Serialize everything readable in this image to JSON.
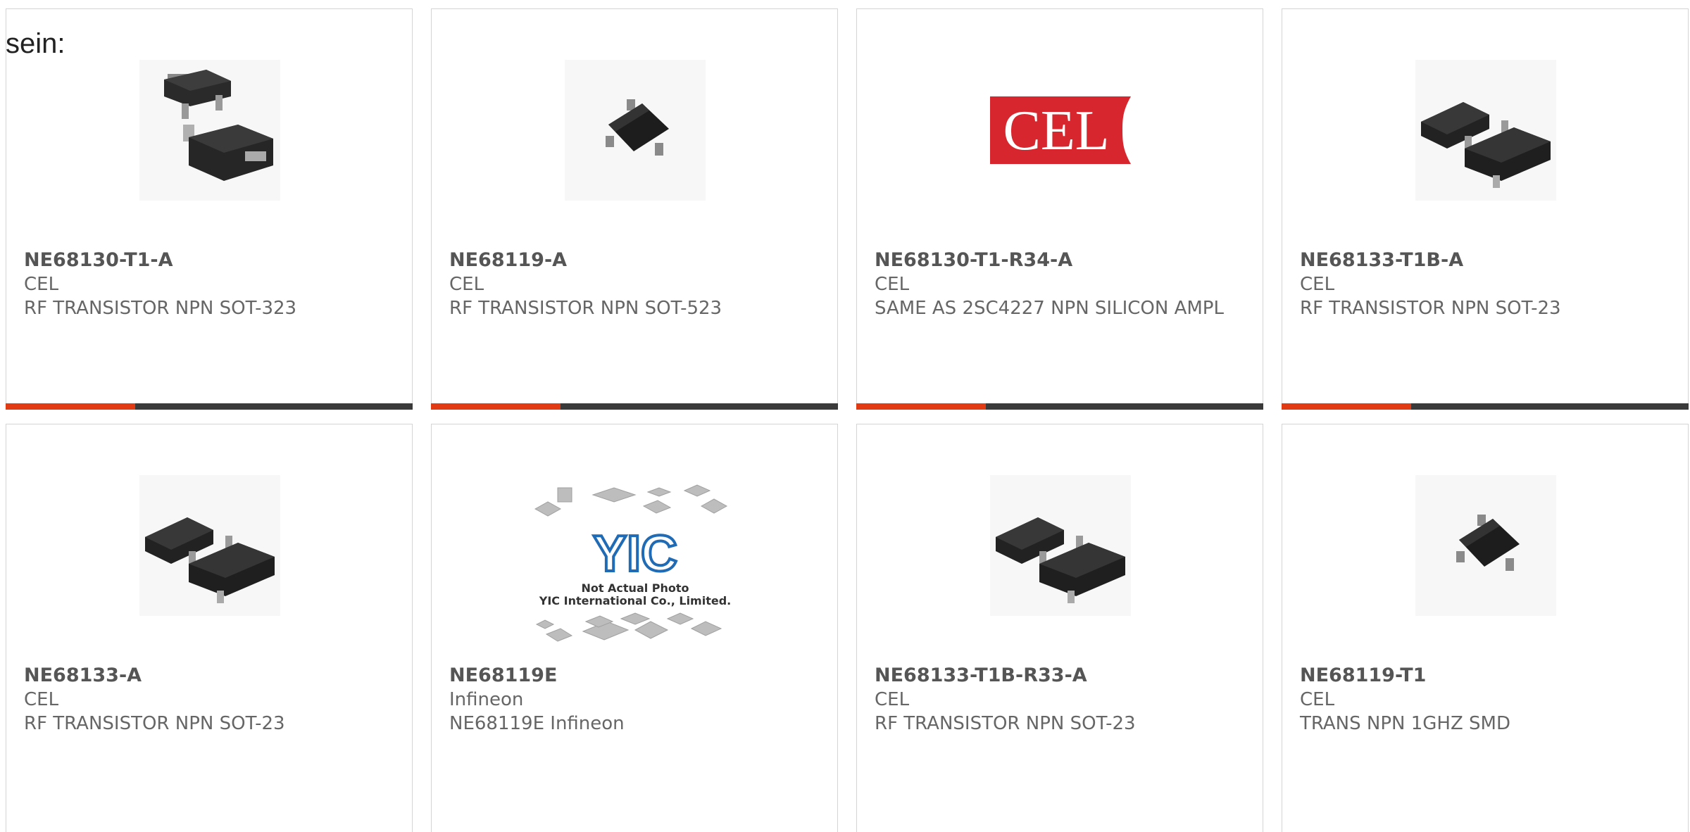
{
  "intro_text": "sein:",
  "colors": {
    "accent": "#e23a12",
    "bar": "#3a3a3a",
    "logo_red": "#d7262d"
  },
  "cel_logo_text": "CEL",
  "placeholder_image": {
    "logo_text": "YIC",
    "line1": "Not Actual Photo",
    "line2": "YIC International Co., Limited."
  },
  "products": [
    {
      "part_number": "NE68130-T1-A",
      "manufacturer": "CEL",
      "description": "RF TRANSISTOR NPN SOT-323",
      "image": "sot323-transistor-photo"
    },
    {
      "part_number": "NE68119-A",
      "manufacturer": "CEL",
      "description": "RF TRANSISTOR NPN SOT-523",
      "image": "sot523-transistor-photo"
    },
    {
      "part_number": "NE68130-T1-R34-A",
      "manufacturer": "CEL",
      "description": "SAME AS 2SC4227 NPN SILICON AMPL",
      "image": "cel-logo"
    },
    {
      "part_number": "NE68133-T1B-A",
      "manufacturer": "CEL",
      "description": "RF TRANSISTOR NPN SOT-23",
      "image": "sot23-transistor-photo"
    },
    {
      "part_number": "NE68133-A",
      "manufacturer": "CEL",
      "description": "RF TRANSISTOR NPN SOT-23",
      "image": "sot23-transistor-photo"
    },
    {
      "part_number": "NE68119E",
      "manufacturer": "Infineon",
      "description": "NE68119E Infineon",
      "image": "not-actual-photo-placeholder"
    },
    {
      "part_number": "NE68133-T1B-R33-A",
      "manufacturer": "CEL",
      "description": "RF TRANSISTOR NPN SOT-23",
      "image": "sot23-transistor-photo"
    },
    {
      "part_number": "NE68119-T1",
      "manufacturer": "CEL",
      "description": "TRANS NPN 1GHZ SMD",
      "image": "sot523-transistor-photo"
    }
  ]
}
